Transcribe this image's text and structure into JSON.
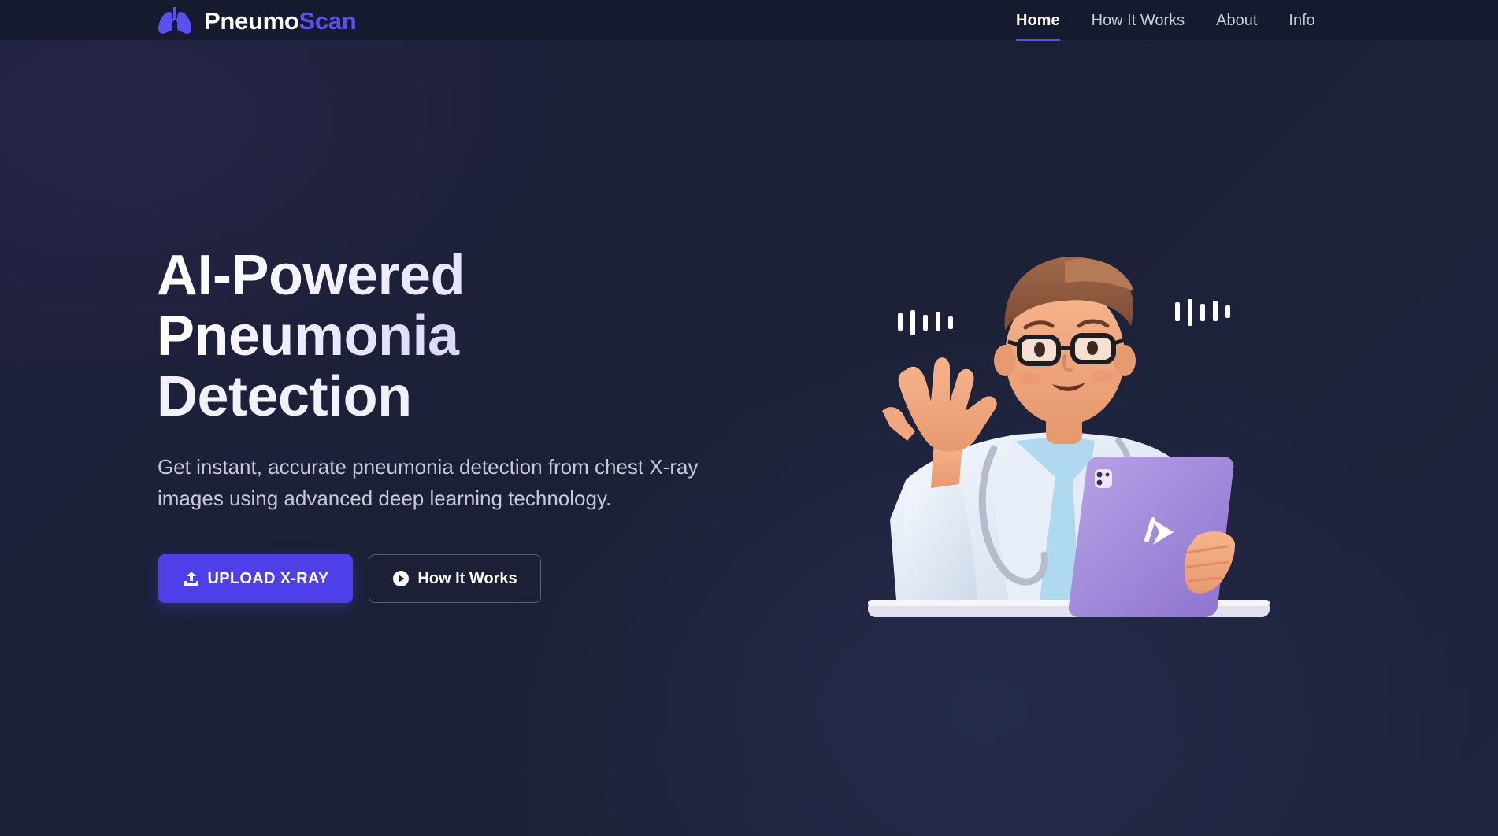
{
  "brand": {
    "name_part1": "Pneumo",
    "name_part2": "Scan"
  },
  "nav": {
    "items": [
      {
        "label": "Home",
        "active": true
      },
      {
        "label": "How It Works",
        "active": false
      },
      {
        "label": "About",
        "active": false
      },
      {
        "label": "Info",
        "active": false
      }
    ]
  },
  "hero": {
    "title_line1": "AI-Powered",
    "title_line2": "Pneumonia",
    "title_line3": "Detection",
    "subtitle": "Get instant, accurate pneumonia detection from chest X-ray images using advanced deep learning technology.",
    "primary_button": "UPLOAD X-RAY",
    "secondary_button": "How It Works"
  },
  "icons": {
    "logo": "lungs-icon",
    "primary_button": "upload-icon",
    "secondary_button": "play-circle-icon",
    "illustration": "doctor-with-tablet-illustration"
  },
  "colors": {
    "accent": "#4f3fe8",
    "brand_accent": "#5b4ff0",
    "navbar_bg": "#161a2e",
    "page_bg": "#1b1f38"
  }
}
